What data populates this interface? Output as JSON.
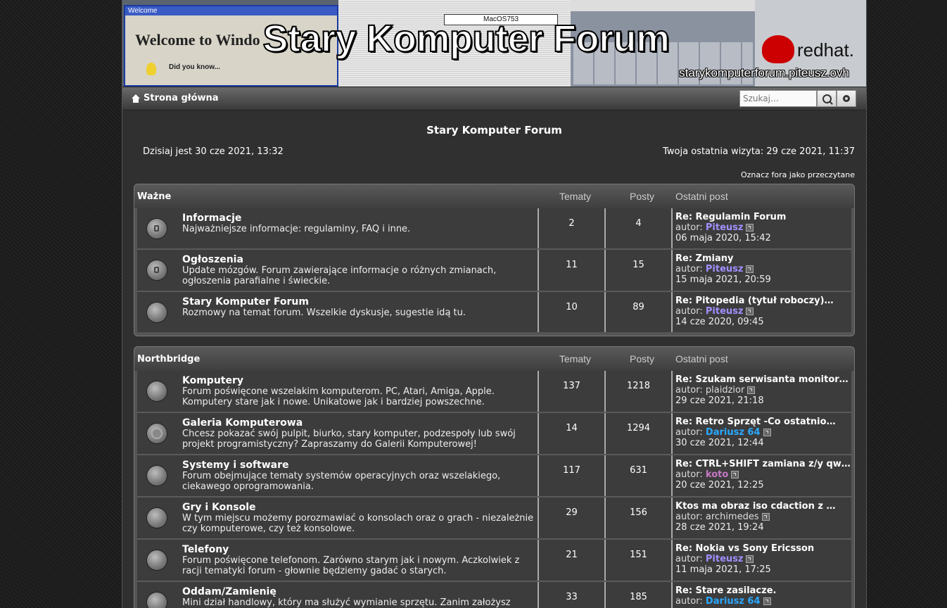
{
  "banner": {
    "title": "Stary Komputer Forum",
    "url": "starykomputerforum.piteusz.ovh",
    "win_bar": "Welcome",
    "win_title": "Welcome to Windo",
    "win_dyk": "Did you know...",
    "mac_title": "MacOS753",
    "rh_text": "redhat."
  },
  "nav": {
    "home": "Strona główna",
    "search_placeholder": "Szukaj…"
  },
  "page": {
    "title": "Stary Komputer Forum",
    "today": "Dzisiaj jest 30 cze 2021, 13:32",
    "last_visit": "Twoja ostatnia wizyta: 29 cze 2021, 11:37",
    "mark_read": "Oznacz fora jako przeczytane"
  },
  "columns": {
    "topics": "Tematy",
    "posts": "Posty",
    "last": "Ostatni post"
  },
  "cat1": {
    "name": "Ważne",
    "forums": [
      {
        "name": "Informacje",
        "desc": "Najważniejsze informacje: regulaminy, FAQ i inne.",
        "topics": "2",
        "posts": "4",
        "last_title": "Re: Regulamin Forum",
        "author_label": "autor:",
        "author": "Piteusz",
        "date": "06 maja 2020, 15:42"
      },
      {
        "name": "Ogłoszenia",
        "desc": "Update mózgów. Forum zawierające informacje o różnych zmianach, ogłoszenia parafialne i świeckie.",
        "topics": "11",
        "posts": "15",
        "last_title": "Re: Zmiany",
        "author_label": "autor:",
        "author": "Piteusz",
        "date": "15 maja 2021, 20:59"
      },
      {
        "name": "Stary Komputer Forum",
        "desc": "Rozmowy na temat forum. Wszelkie dyskusje, sugestie idą tu.",
        "topics": "10",
        "posts": "89",
        "last_title": "Re: Pitopedia (tytuł roboczy)…",
        "author_label": "autor:",
        "author": "Piteusz",
        "date": "14 cze 2020, 09:45"
      }
    ]
  },
  "cat2": {
    "name": "Northbridge",
    "forums": [
      {
        "name": "Komputery",
        "desc": "Forum poświęcone wszelakim komputerom. PC, Atari, Amiga, Apple. Komputery stare jak i nowe. Unikatowe jak i bardziej powszechne.",
        "topics": "137",
        "posts": "1218",
        "last_title": "Re: Szukam serwisanta monitor…",
        "author_label": "autor:",
        "author": "plaidzior",
        "date": "29 cze 2021, 21:18"
      },
      {
        "name": "Galeria Komputerowa",
        "desc": "Chcesz pokazać swój pulpit, biurko, stary komputer, podzespoły lub swój projekt programistyczny? Zapraszamy do Galerii Komputerowej!",
        "topics": "14",
        "posts": "1294",
        "last_title": "Re: Retro Sprzęt -Co ostatnio…",
        "author_label": "autor:",
        "author": "Dariusz 64",
        "date": "30 cze 2021, 12:44"
      },
      {
        "name": "Systemy i software",
        "desc": "Forum obejmujące tematy systemów operacyjnych oraz wszelakiego, ciekawego oprogramowania.",
        "topics": "117",
        "posts": "631",
        "last_title": "Re: CTRL+SHIFT zamiana z/y qw…",
        "author_label": "autor:",
        "author": "koto",
        "date": "20 cze 2021, 12:25"
      },
      {
        "name": "Gry i Konsole",
        "desc": "W tym miejscu możemy porozmawiać o konsolach oraz o grach - niezależnie czy komputerowe, czy też konsolowe.",
        "topics": "29",
        "posts": "156",
        "last_title": "Ktos ma obraz iso cdaction z …",
        "author_label": "autor:",
        "author": "archimedes",
        "date": "28 cze 2021, 19:24"
      },
      {
        "name": "Telefony",
        "desc": "Forum poświęcone telefonom. Zarówno starym jak i nowym. Aczkolwiek z racji tematyki forum - głownie będziemy gadać o starych.",
        "topics": "21",
        "posts": "151",
        "last_title": "Re: Nokia vs Sony Ericsson",
        "author_label": "autor:",
        "author": "Piteusz",
        "date": "11 maja 2021, 17:25"
      },
      {
        "name": "Oddam/Zamienię",
        "desc": "Mini dział handlowy, który ma służyć wymianie sprzętu. Zanim założysz",
        "topics": "33",
        "posts": "185",
        "last_title": "Re: Stare zasilacze.",
        "author_label": "autor:",
        "author": "Dariusz 64",
        "date": ""
      }
    ]
  },
  "colors": {
    "accent_user": "#a090ff",
    "blue_user": "#2aa8ff",
    "pink_user": "#c878c8"
  },
  "icons": [
    "home-icon",
    "search-icon",
    "gear-icon",
    "forum-read-icon",
    "forum-locked-icon",
    "forum-subforum-icon",
    "goto-post-icon"
  ]
}
